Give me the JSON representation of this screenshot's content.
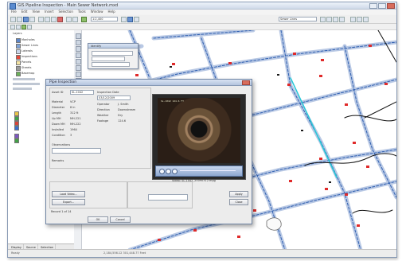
{
  "window": {
    "title": "GIS Pipeline Inspection - Main Sewer Network.mxd"
  },
  "menu": [
    "File",
    "Edit",
    "View",
    "Insert",
    "Selection",
    "Tools",
    "Window",
    "Help"
  ],
  "toolbar": {
    "scale_value": "1:2,400",
    "layer_combo": "Sewer Lines"
  },
  "left_panel": {
    "tabs": [
      "Display",
      "Source",
      "Selection"
    ],
    "tree": [
      "Layers",
      "Manholes",
      "Sewer Lines",
      "Laterals",
      "Inspections",
      "Parcels",
      "Streets",
      "Basemap"
    ]
  },
  "mini_dialog": {
    "title": "Identify"
  },
  "dialog": {
    "title": "Pipe Inspection",
    "fields": [
      {
        "label": "Asset ID",
        "value": "SL-1042"
      },
      {
        "label": "Material",
        "value": "VCP"
      },
      {
        "label": "Diameter",
        "value": "8 in"
      },
      {
        "label": "Length",
        "value": "312 ft"
      },
      {
        "label": "Up MH",
        "value": "MH-221"
      },
      {
        "label": "Down MH",
        "value": "MH-222"
      },
      {
        "label": "Installed",
        "value": "1964"
      },
      {
        "label": "Condition",
        "value": "3"
      }
    ],
    "right_fields": [
      {
        "label": "Inspection Date",
        "value": "03/12/2009"
      },
      {
        "label": "Operator",
        "value": "J. Smith"
      },
      {
        "label": "Direction",
        "value": "Downstream"
      },
      {
        "label": "Weather",
        "value": "Dry"
      },
      {
        "label": "Footage",
        "value": "124.6"
      }
    ],
    "notes_label": "Observations",
    "remarks_label": "Remarks",
    "video_caption": "Video: SL-1042_20090312.mpg",
    "video_osd": "SL-1042  124.6 FT",
    "buttons": {
      "load_video": "Load Video...",
      "export": "Export...",
      "ok": "OK",
      "cancel": "Cancel",
      "apply": "Apply",
      "close": "Close"
    },
    "footer_label": "Record 1 of 14"
  },
  "status": {
    "coords": "2,184,556.12  301,448.77 Feet",
    "left": "Ready"
  }
}
